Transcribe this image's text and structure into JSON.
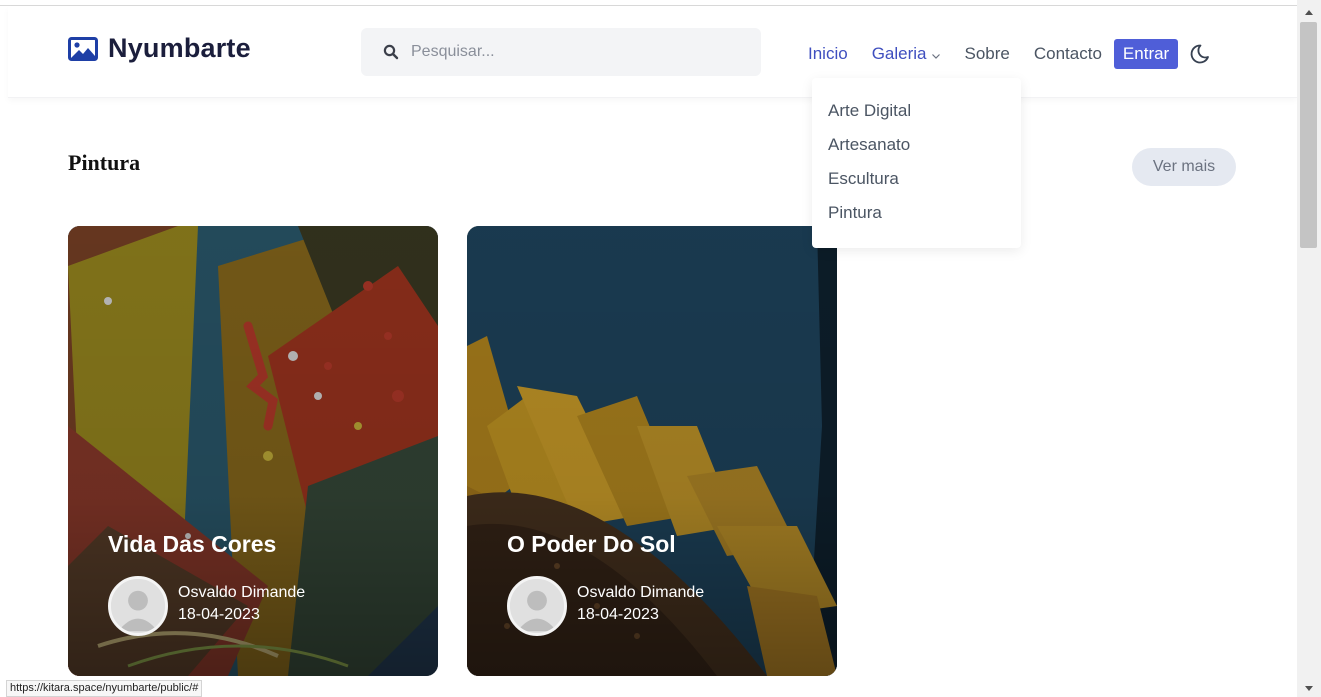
{
  "header": {
    "brand_name": "Nyumbarte",
    "search_placeholder": "Pesquisar...",
    "nav": {
      "inicio": "Inicio",
      "galeria": "Galeria",
      "sobre": "Sobre",
      "contacto": "Contacto",
      "entrar": "Entrar"
    },
    "accent_color": "#4f5ed8"
  },
  "dropdown": {
    "items": [
      "Arte Digital",
      "Artesanato",
      "Escultura",
      "Pintura"
    ]
  },
  "section": {
    "title": "Pintura",
    "ver_mais": "Ver mais"
  },
  "cards": [
    {
      "title": "Vida Das Cores",
      "author": "Osvaldo Dimande",
      "date": "18-04-2023"
    },
    {
      "title": "O Poder Do Sol",
      "author": "Osvaldo Dimande",
      "date": "18-04-2023"
    }
  ],
  "status_bar": {
    "url": "https://kitara.space/nyumbarte/public/#"
  }
}
